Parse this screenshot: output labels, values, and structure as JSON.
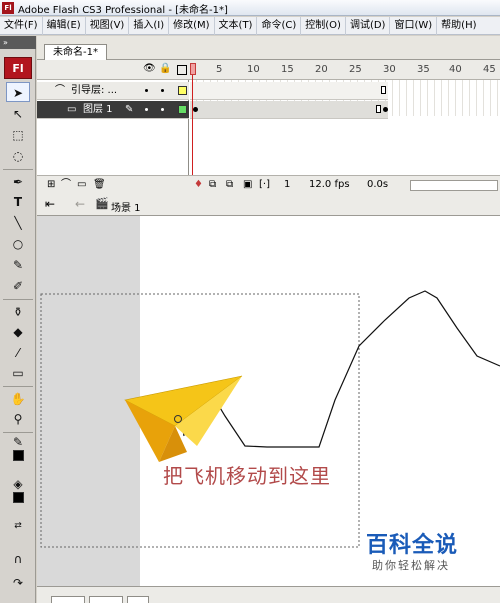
{
  "window": {
    "title": "Adobe Flash CS3 Professional - [未命名-1*]",
    "app_icon": "Fl"
  },
  "menu": [
    "文件(F)",
    "编辑(E)",
    "视图(V)",
    "插入(I)",
    "修改(M)",
    "文本(T)",
    "命令(C)",
    "控制(O)",
    "调试(D)",
    "窗口(W)",
    "帮助(H)"
  ],
  "tools": {
    "logo": "Fl",
    "panel_grip": "»",
    "icons": [
      "selection-arrow-icon",
      "subselection-icon",
      "free-transform-icon",
      "lasso-icon",
      "pen-icon",
      "text-tool-icon",
      "line-tool-icon",
      "oval-tool-icon",
      "pencil-icon",
      "brush-icon",
      "ink-bottle-icon",
      "paint-bucket-icon",
      "eyedropper-icon",
      "eraser-icon",
      "hand-icon",
      "zoom-icon",
      "stroke-color-icon",
      "fill-color-icon",
      "snap-magnet-icon"
    ],
    "text_tool_glyph": "T"
  },
  "document": {
    "tab_label": "未命名-1*"
  },
  "timeline": {
    "frame_numbers": [
      "5",
      "10",
      "15",
      "20",
      "25",
      "30",
      "35",
      "40",
      "45"
    ],
    "layers": [
      {
        "name": "引导层: ...",
        "type": "guide",
        "color": "#ffff66"
      },
      {
        "name": "图层 1",
        "type": "normal",
        "color": "#66dd66"
      }
    ],
    "footer": {
      "current_frame": "1",
      "fps": "12.0 fps",
      "time": "0.0s"
    }
  },
  "editbar": {
    "scene_label": "场景 1"
  },
  "stage": {
    "caption": "把飞机移动到这里"
  },
  "watermark": {
    "title": "百科全说",
    "subtitle": "助你轻松解决"
  },
  "colors": {
    "accent": "#b2151e",
    "plane_yellow": "#f5c518",
    "caption": "#b24a4a",
    "watermark_blue": "#1a5bb8"
  }
}
